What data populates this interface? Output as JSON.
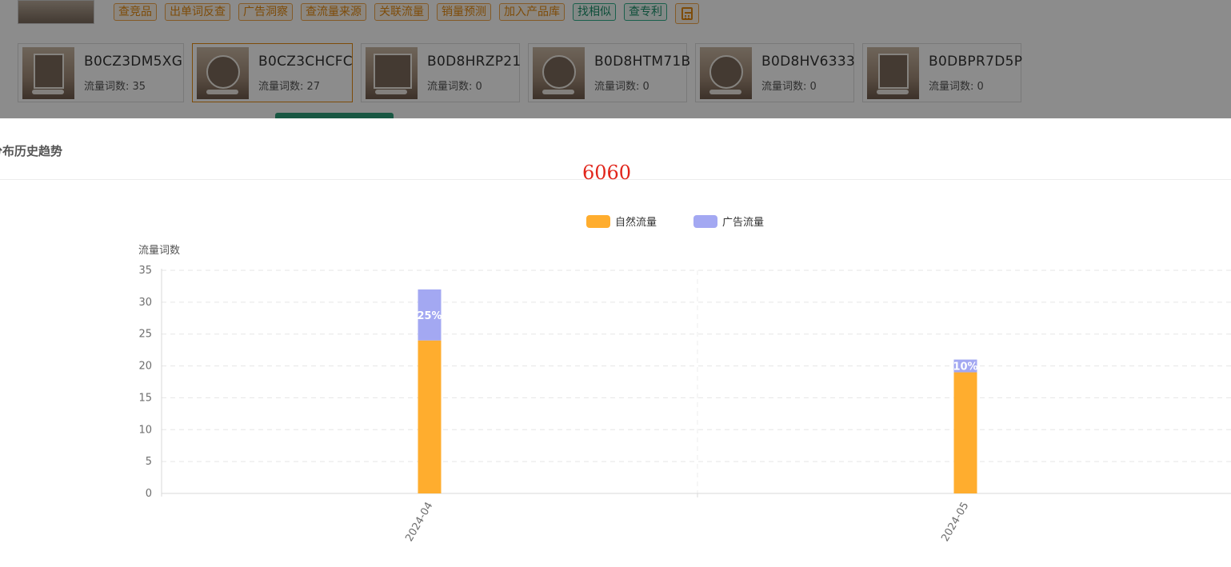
{
  "toolbar": {
    "buttons": [
      "查竞品",
      "出单词反查",
      "广告洞察",
      "查流量来源",
      "关联流量",
      "销量预测",
      "加入产品库",
      "找相似",
      "查专利"
    ],
    "calculator_icon": "calculator-icon"
  },
  "products": [
    {
      "asin": "B0CZ3DM5XG",
      "count_label": "流量词数: 35",
      "selected": false
    },
    {
      "asin": "B0CZ3CHCFC",
      "count_label": "流量词数: 27",
      "selected": true
    },
    {
      "asin": "B0D8HRZP21",
      "count_label": "流量词数: 0",
      "selected": false
    },
    {
      "asin": "B0D8HTM71B",
      "count_label": "流量词数: 0",
      "selected": false
    },
    {
      "asin": "B0D8HV6333",
      "count_label": "流量词数: 0",
      "selected": false
    },
    {
      "asin": "B0DBPR7D5P",
      "count_label": "流量词数: 0",
      "selected": false
    }
  ],
  "modal": {
    "title": "分布历史趋势",
    "big_number": "6060"
  },
  "colors": {
    "natural": "#FFAD2E",
    "ad": "#A3A8F2",
    "accent": "#E58A11",
    "highlight_red": "#E1251B"
  },
  "chart_data": {
    "type": "bar",
    "stacked": true,
    "categories": [
      "2024-04",
      "2024-05"
    ],
    "series": [
      {
        "name": "自然流量",
        "values": [
          24,
          19
        ]
      },
      {
        "name": "广告流量",
        "values": [
          8,
          2
        ]
      }
    ],
    "bar_labels": [
      "25%",
      "10%"
    ],
    "ylabel": "流量词数",
    "ylim": [
      0,
      35
    ],
    "yticks": [
      0,
      5,
      10,
      15,
      20,
      25,
      30,
      35
    ],
    "grid": true,
    "legend_position": "top-center"
  }
}
